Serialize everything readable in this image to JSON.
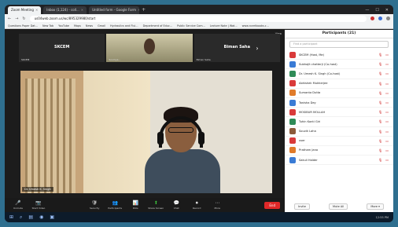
{
  "browser": {
    "tabs": [
      {
        "label": "Zoom Meeting",
        "active": true
      },
      {
        "label": "Inbox (1,124) - coll...",
        "active": false
      },
      {
        "label": "Untitled form - Google Form",
        "active": false
      }
    ],
    "url": "us04web.zoom.us/wc/895329980/start",
    "bookmarks": [
      "Questions Paper Dat...",
      "New Tab",
      "YouTube",
      "Maps",
      "News",
      "Gmail",
      "Hydraulics and Flui...",
      "Department of Educ...",
      "Public Service Com...",
      "Lecture Note | Wat...",
      "www.ncertbooks.c..."
    ]
  },
  "strip": [
    {
      "name": "SKCEM",
      "tag": "SKCEM"
    },
    {
      "name": "",
      "tag": "Soumya..."
    },
    {
      "name": "Biman Saha",
      "tag": "Biman Saha"
    }
  ],
  "view_label": "View",
  "main_name": "Dr. Umesh K. Singh",
  "toolbar": [
    {
      "label": "Unmute",
      "icon": "🎤"
    },
    {
      "label": "Start Video",
      "icon": "📷"
    },
    {
      "label": "Security",
      "icon": "🛡"
    },
    {
      "label": "Participants",
      "icon": "👥"
    },
    {
      "label": "Polls",
      "icon": "📊"
    },
    {
      "label": "Share Screen",
      "icon": "⬆"
    },
    {
      "label": "Chat",
      "icon": "💬"
    },
    {
      "label": "Record",
      "icon": "⏺"
    },
    {
      "label": "More",
      "icon": "⋯"
    }
  ],
  "end_label": "End",
  "participants": {
    "title": "Participants (21)",
    "search_placeholder": "Find a participant",
    "list": [
      {
        "name": "SKCEM (Host, Me)",
        "color": "#d93a3a"
      },
      {
        "name": "Subhajit chatterji (Co-host)",
        "color": "#3a7bd5"
      },
      {
        "name": "Dr. Umesh K. Singh (Co-host)",
        "color": "#2e8b57"
      },
      {
        "name": "Abhishek Mukherjee",
        "color": "#d93a3a"
      },
      {
        "name": "Sumanta Dutta",
        "color": "#e07b2a"
      },
      {
        "name": "Tanisha Dey",
        "color": "#3a7bd5"
      },
      {
        "name": "MOSIBUR MOLLAH",
        "color": "#d93a3a"
      },
      {
        "name": "Tuhin Kanti Giri",
        "color": "#2e8b57"
      },
      {
        "name": "Souvik Laha",
        "color": "#8c5a3a"
      },
      {
        "name": "user",
        "color": "#d93a3a"
      },
      {
        "name": "Pratham Jana",
        "color": "#e07b2a"
      },
      {
        "name": "Sakuli Halder",
        "color": "#3a7bd5"
      }
    ],
    "invite": "Invite",
    "mute_all": "Mute All",
    "more": "More ▾"
  },
  "tray_time": "12:55 PM"
}
